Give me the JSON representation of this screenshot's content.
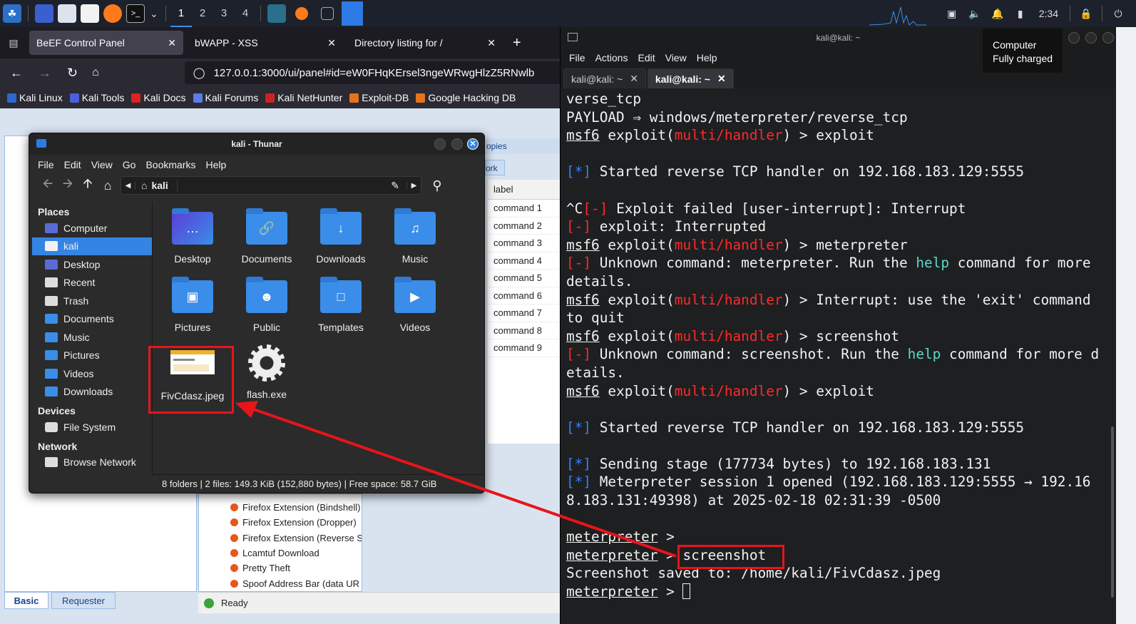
{
  "taskbar": {
    "workspaces": [
      "1",
      "2",
      "3",
      "4"
    ],
    "clock": "2:34"
  },
  "tooltip": {
    "title": "Computer",
    "status": "Fully charged"
  },
  "firefox": {
    "tabs": [
      {
        "label": "BeEF Control Panel"
      },
      {
        "label": "bWAPP - XSS"
      },
      {
        "label": "Directory listing for /"
      }
    ],
    "url": "127.0.0.1:3000/ui/panel#id=eW0FHqKErsel3ngeWRwgHlzZ5RNwlb",
    "bookmarks": [
      "Kali Linux",
      "Kali Tools",
      "Kali Docs",
      "Kali Forums",
      "Kali NetHunter",
      "Exploit-DB",
      "Google Hacking DB"
    ]
  },
  "beef": {
    "tab_partial": "opies",
    "tab_partial2": "ork",
    "label_header": "label",
    "commands": [
      "command 1",
      "command 2",
      "command 3",
      "command 4",
      "command 5",
      "command 6",
      "command 7",
      "command 8",
      "command 9"
    ],
    "modules": [
      "Firefox Extension (Bindshell)",
      "Firefox Extension (Dropper)",
      "Firefox Extension (Reverse S",
      "Lcamtuf Download",
      "Pretty Theft",
      "Spoof Address Bar (data UR"
    ],
    "bottom_tabs": [
      "Basic",
      "Requester"
    ],
    "status": "Ready"
  },
  "thunar": {
    "title": "kali - Thunar",
    "menu": [
      "File",
      "Edit",
      "View",
      "Go",
      "Bookmarks",
      "Help"
    ],
    "path": "kali",
    "places_header": "Places",
    "places": [
      "Computer",
      "kali",
      "Desktop",
      "Recent",
      "Trash",
      "Documents",
      "Music",
      "Pictures",
      "Videos",
      "Downloads"
    ],
    "devices_header": "Devices",
    "devices": [
      "File System"
    ],
    "network_header": "Network",
    "network": [
      "Browse Network"
    ],
    "items": [
      "Desktop",
      "Documents",
      "Downloads",
      "Music",
      "Pictures",
      "Public",
      "Templates",
      "Videos",
      "FivCdasz.jpeg",
      "flash.exe"
    ],
    "status": "8 folders  |  2 files: 149.3 KiB (152,880 bytes)  |  Free space: 58.7 GiB"
  },
  "terminal": {
    "title": "kali@kali: ~",
    "menu": [
      "File",
      "Actions",
      "Edit",
      "View",
      "Help"
    ],
    "tabs": [
      "kali@kali: ~",
      "kali@kali: ~"
    ]
  },
  "colors": {
    "accent": "#3584e4",
    "annotation": "#e8141a",
    "prompt_red": "#ff2a2a",
    "info_blue": "#3a7ff2"
  }
}
